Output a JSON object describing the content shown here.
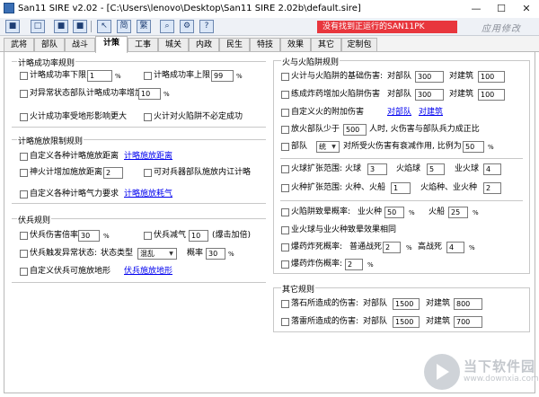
{
  "window": {
    "title": "San11 SIRE v2.02 - [C:\\Users\\lenovo\\Desktop\\San11 SIRE 2.02b\\default.sire]",
    "minimize": "—",
    "maximize": "☐",
    "close": "✕"
  },
  "toolbar": {
    "icons": [
      "■",
      "□",
      "■",
      "■",
      "↖",
      "简",
      "繁",
      "⌕",
      "⚙",
      "?"
    ],
    "status_warning": "没有找到正运行的SAN11PK",
    "apply_label": "应用修改"
  },
  "tabs": [
    "武将",
    "部队",
    "战斗",
    "计策",
    "工事",
    "城关",
    "内政",
    "民生",
    "特技",
    "效果",
    "其它",
    "定制包"
  ],
  "active_tab": "计策",
  "groups": {
    "plot_success": {
      "title": "计略成功率规则",
      "min_label": "计略成功率下限",
      "min_value": "1",
      "min_unit": "%",
      "max_label": "计略成功率上限",
      "max_value": "99",
      "max_unit": "%",
      "abnormal_label": "对异常状态部队计略成功率增加",
      "abnormal_value": "10",
      "abnormal_unit": "%",
      "terrain_label": "火计成功率受地形影响更大",
      "fire_label": "火计对火陷阱不必定成功"
    },
    "plot_range": {
      "title": "计略施放限制规则",
      "custom_range_label": "自定义各种计略施放距离",
      "custom_range_link": "计略施放距离",
      "divine_fire_label": "神火计增加施放距离",
      "divine_fire_value": "2",
      "siege_label": "可对兵器部队施放内讧计略",
      "custom_energy_label": "自定义各种计略气力要求",
      "custom_energy_link": "计略施放耗气"
    },
    "ambush": {
      "title": "伏兵规则",
      "damage_label": "伏兵伤害倍率",
      "damage_value": "30",
      "damage_unit": "%",
      "morale_label": "伏兵减气",
      "morale_value": "10",
      "morale_note": "(爆击加倍)",
      "status_label": "伏兵触发异常状态:",
      "status_type_label": "状态类型",
      "status_type_value": "混乱",
      "chance_label": "概率",
      "chance_value": "30",
      "chance_unit": "%",
      "terrain_label": "自定义伏兵可施放地形",
      "terrain_link": "伏兵施放地形"
    },
    "fire_trap": {
      "title": "火与火陷阱规则",
      "base_damage_label": "火计与火陷阱的基础伤害:",
      "base_troop_label": "对部队",
      "base_troop_value": "300",
      "base_building_label": "对建筑",
      "base_building_value": "100",
      "training_label": "练成炸药增加火陷阱伤害",
      "training_troop_label": "对部队",
      "training_troop_value": "300",
      "training_building_label": "对建筑",
      "training_building_value": "100",
      "custom_fire_label": "自定义火的附加伤害",
      "custom_fire_troop_link": "对部队",
      "custom_fire_building_link": "对建筑",
      "fire_troops_label": "放火部队少于",
      "fire_troops_value": "500",
      "fire_troops_suffix": "人时, 火伤害与部队兵力成正比",
      "unit_label": "部队",
      "unit_select": "统",
      "unit_suffix": "对所受火伤害有衰减作用, 比例为",
      "unit_ratio": "50",
      "unit_ratio_unit": "%",
      "fire_ball_label": "火球扩张范围:",
      "fire_ball_a_label": "火球",
      "fire_ball_a": "3",
      "fire_ball_b_label": "火焰球",
      "fire_ball_b": "5",
      "fire_ball_c_label": "业火球",
      "fire_ball_c": "4",
      "fire_ship_label": "火种扩张范围:",
      "fire_ship_a_label": "火种、火船",
      "fire_ship_a": "1",
      "fire_ship_b_label": "火焰种、业火种",
      "fire_ship_b": "2",
      "trap_count_label": "火陷阱致晕概率:",
      "trap_a_label": "业火种",
      "trap_a": "50",
      "trap_a_unit": "%",
      "trap_b_label": "火船",
      "trap_b": "25",
      "trap_b_unit": "%",
      "same_effect_label": "业火球与业火种致晕效果相同",
      "explode_label": "爆药炸死概率:",
      "explode_normal_label": "普通战死",
      "explode_normal": "2",
      "explode_normal_unit": "%",
      "explode_high_label": "高战死",
      "explode_high": "4",
      "explode_high_unit": "%",
      "explode_hurt_label": "爆药炸伤概率:",
      "explode_hurt": "2",
      "explode_hurt_unit": "%"
    },
    "other": {
      "title": "其它规则",
      "rock_label": "落石所造成的伤害:",
      "rock_troop_label": "对部队",
      "rock_troop": "1500",
      "rock_building_label": "对建筑",
      "rock_building": "800",
      "thunder_label": "落雷所造成的伤害:",
      "thunder_troop_label": "对部队",
      "thunder_troop": "1500",
      "thunder_building_label": "对建筑",
      "thunder_building": "700"
    }
  },
  "watermark": {
    "title": "当下软件园",
    "url": "www.downxia.com"
  }
}
